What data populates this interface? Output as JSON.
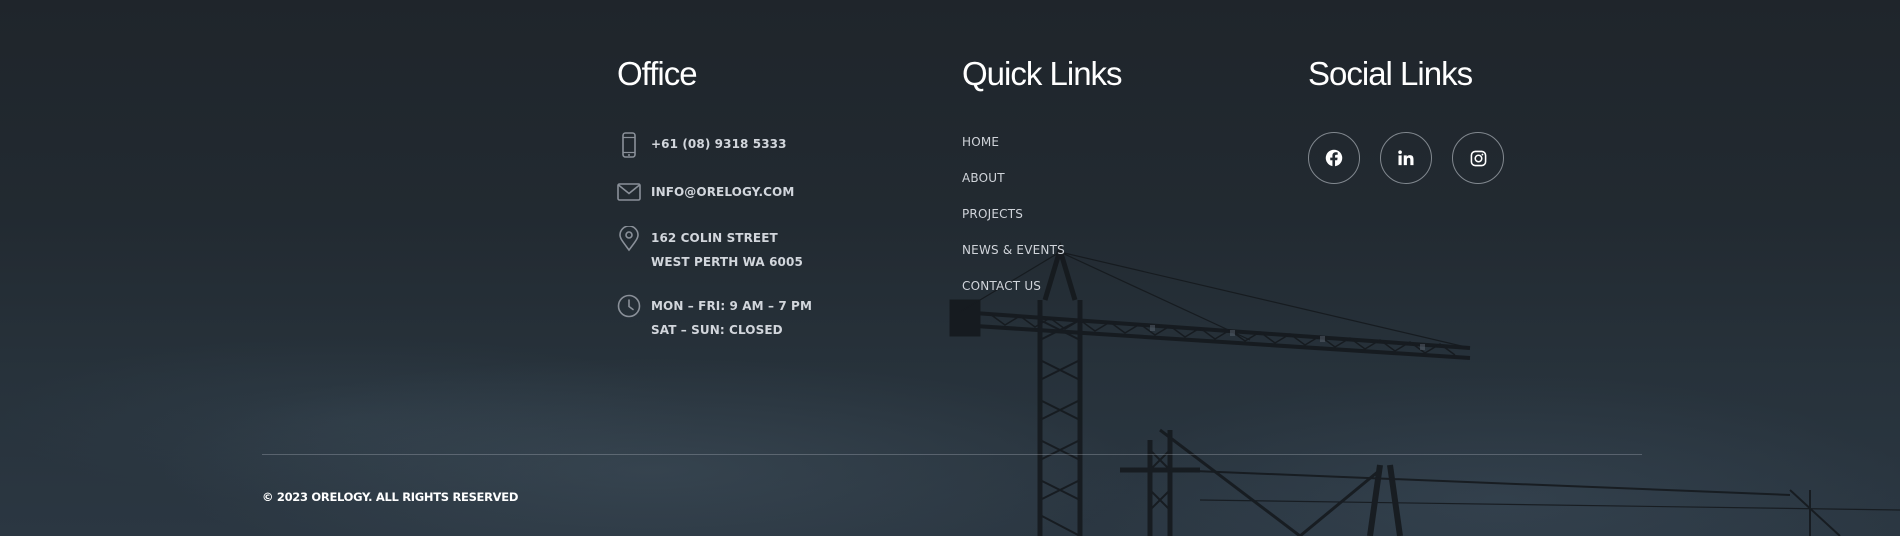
{
  "office": {
    "heading": "Office",
    "phone": "+61 (08) 9318 5333",
    "email": "INFO@ORELOGY.COM",
    "address_line1": "162 COLIN STREET",
    "address_line2": "WEST PERTH WA 6005",
    "hours_line1": "MON – FRI: 9 AM – 7 PM",
    "hours_line2": "SAT – SUN: CLOSED"
  },
  "quick_links": {
    "heading": "Quick Links",
    "items": [
      "HOME",
      "ABOUT",
      "PROJECTS",
      "NEWS & EVENTS",
      "CONTACT US"
    ]
  },
  "social_links": {
    "heading": "Social Links",
    "icons": [
      "facebook-icon",
      "linkedin-icon",
      "instagram-icon"
    ]
  },
  "footer": {
    "copyright": "© 2023 ORELOGY. ALL RIGHTS RESERVED"
  },
  "colors": {
    "background": "#1f252b",
    "heading": "#ffffff",
    "text": "#d2d6dc",
    "icon": "#8a9099"
  }
}
